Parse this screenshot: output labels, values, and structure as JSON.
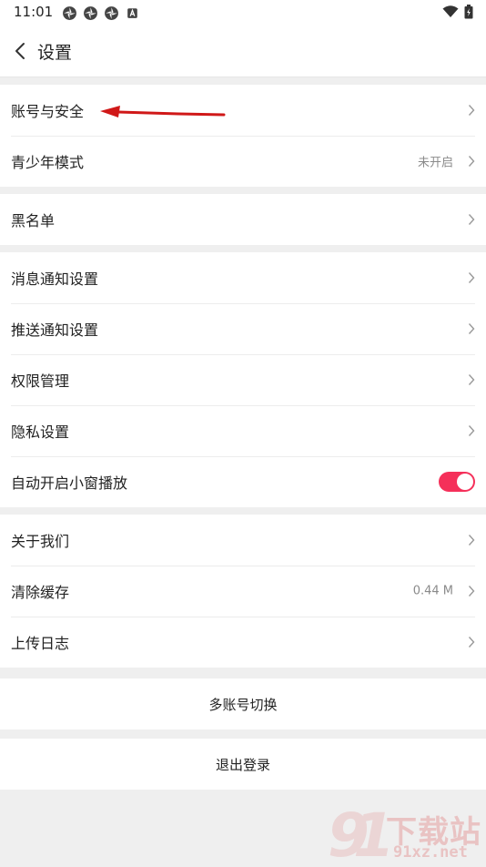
{
  "status": {
    "time": "11:01"
  },
  "nav": {
    "title": "设置"
  },
  "groups": [
    {
      "items": [
        {
          "label": "账号与安全"
        },
        {
          "label": "青少年模式",
          "value": "未开启"
        }
      ]
    },
    {
      "items": [
        {
          "label": "黑名单"
        }
      ]
    },
    {
      "items": [
        {
          "label": "消息通知设置"
        },
        {
          "label": "推送通知设置"
        },
        {
          "label": "权限管理"
        },
        {
          "label": "隐私设置"
        },
        {
          "label": "自动开启小窗播放",
          "toggle": true
        }
      ]
    },
    {
      "items": [
        {
          "label": "关于我们"
        },
        {
          "label": "清除缓存",
          "value": "0.44 M"
        },
        {
          "label": "上传日志"
        }
      ]
    }
  ],
  "actions": {
    "switch_account": "多账号切换",
    "logout": "退出登录"
  },
  "watermark": {
    "text_cn": "下载站",
    "text_en": "91xz.net"
  },
  "colors": {
    "accent": "#f5305a",
    "annotation": "#d01818"
  }
}
